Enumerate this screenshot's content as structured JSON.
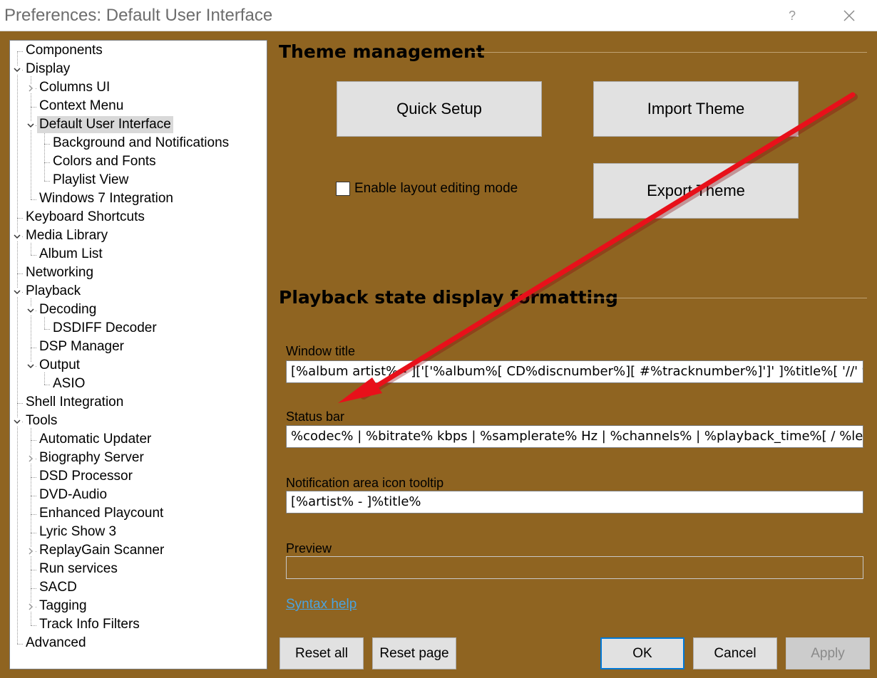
{
  "window": {
    "title": "Preferences: Default User Interface",
    "help_label": "?",
    "close_icon": "close-icon"
  },
  "tree": {
    "items": [
      {
        "label": "Components",
        "level": 0,
        "expander": "none"
      },
      {
        "label": "Display",
        "level": 0,
        "expander": "expanded"
      },
      {
        "label": "Columns UI",
        "level": 1,
        "expander": "collapsed"
      },
      {
        "label": "Context Menu",
        "level": 1,
        "expander": "none"
      },
      {
        "label": "Default User Interface",
        "level": 1,
        "expander": "expanded",
        "selected": true
      },
      {
        "label": "Background and Notifications",
        "level": 2,
        "expander": "none"
      },
      {
        "label": "Colors and Fonts",
        "level": 2,
        "expander": "none"
      },
      {
        "label": "Playlist View",
        "level": 2,
        "expander": "none"
      },
      {
        "label": "Windows 7 Integration",
        "level": 1,
        "expander": "none"
      },
      {
        "label": "Keyboard Shortcuts",
        "level": 0,
        "expander": "none"
      },
      {
        "label": "Media Library",
        "level": 0,
        "expander": "expanded"
      },
      {
        "label": "Album List",
        "level": 1,
        "expander": "none"
      },
      {
        "label": "Networking",
        "level": 0,
        "expander": "none"
      },
      {
        "label": "Playback",
        "level": 0,
        "expander": "expanded"
      },
      {
        "label": "Decoding",
        "level": 1,
        "expander": "expanded"
      },
      {
        "label": "DSDIFF Decoder",
        "level": 2,
        "expander": "none"
      },
      {
        "label": "DSP Manager",
        "level": 1,
        "expander": "none"
      },
      {
        "label": "Output",
        "level": 1,
        "expander": "expanded"
      },
      {
        "label": "ASIO",
        "level": 2,
        "expander": "none"
      },
      {
        "label": "Shell Integration",
        "level": 0,
        "expander": "none"
      },
      {
        "label": "Tools",
        "level": 0,
        "expander": "expanded"
      },
      {
        "label": "Automatic Updater",
        "level": 1,
        "expander": "none"
      },
      {
        "label": "Biography Server",
        "level": 1,
        "expander": "collapsed"
      },
      {
        "label": "DSD Processor",
        "level": 1,
        "expander": "none"
      },
      {
        "label": "DVD-Audio",
        "level": 1,
        "expander": "none"
      },
      {
        "label": "Enhanced Playcount",
        "level": 1,
        "expander": "none"
      },
      {
        "label": "Lyric Show 3",
        "level": 1,
        "expander": "none"
      },
      {
        "label": "ReplayGain Scanner",
        "level": 1,
        "expander": "collapsed"
      },
      {
        "label": "Run services",
        "level": 1,
        "expander": "none"
      },
      {
        "label": "SACD",
        "level": 1,
        "expander": "none"
      },
      {
        "label": "Tagging",
        "level": 1,
        "expander": "collapsed"
      },
      {
        "label": "Track Info Filters",
        "level": 1,
        "expander": "none"
      },
      {
        "label": "Advanced",
        "level": 0,
        "expander": "none"
      }
    ]
  },
  "theme": {
    "heading": "Theme management",
    "quick_setup": "Quick Setup",
    "import_theme": "Import Theme",
    "export_theme": "Export Theme",
    "layout_editing_label": "Enable layout editing mode",
    "layout_editing_checked": false
  },
  "playback": {
    "heading": "Playback state display formatting",
    "window_title_label": "Window title",
    "window_title_value": "[%album artist% - ]['['%album%[ CD%discnumber%][ #%tracknumber%]']' ]%title%[ '//' %track artist%]",
    "status_bar_label": "Status bar",
    "status_bar_value": "%codec% | %bitrate% kbps | %samplerate% Hz | %channels% | %playback_time%[ / %length%]",
    "tooltip_label": "Notification area icon tooltip",
    "tooltip_value": "[%artist% - ]%title%",
    "preview_label": "Preview",
    "syntax_help": "Syntax help"
  },
  "footer": {
    "reset_all": "Reset all",
    "reset_page": "Reset page",
    "ok": "OK",
    "cancel": "Cancel",
    "apply": "Apply"
  },
  "colors": {
    "background": "#8f6421",
    "annotation_arrow": "#e8101a",
    "link": "#4aa3e0",
    "default_button_border": "#0078d7"
  }
}
